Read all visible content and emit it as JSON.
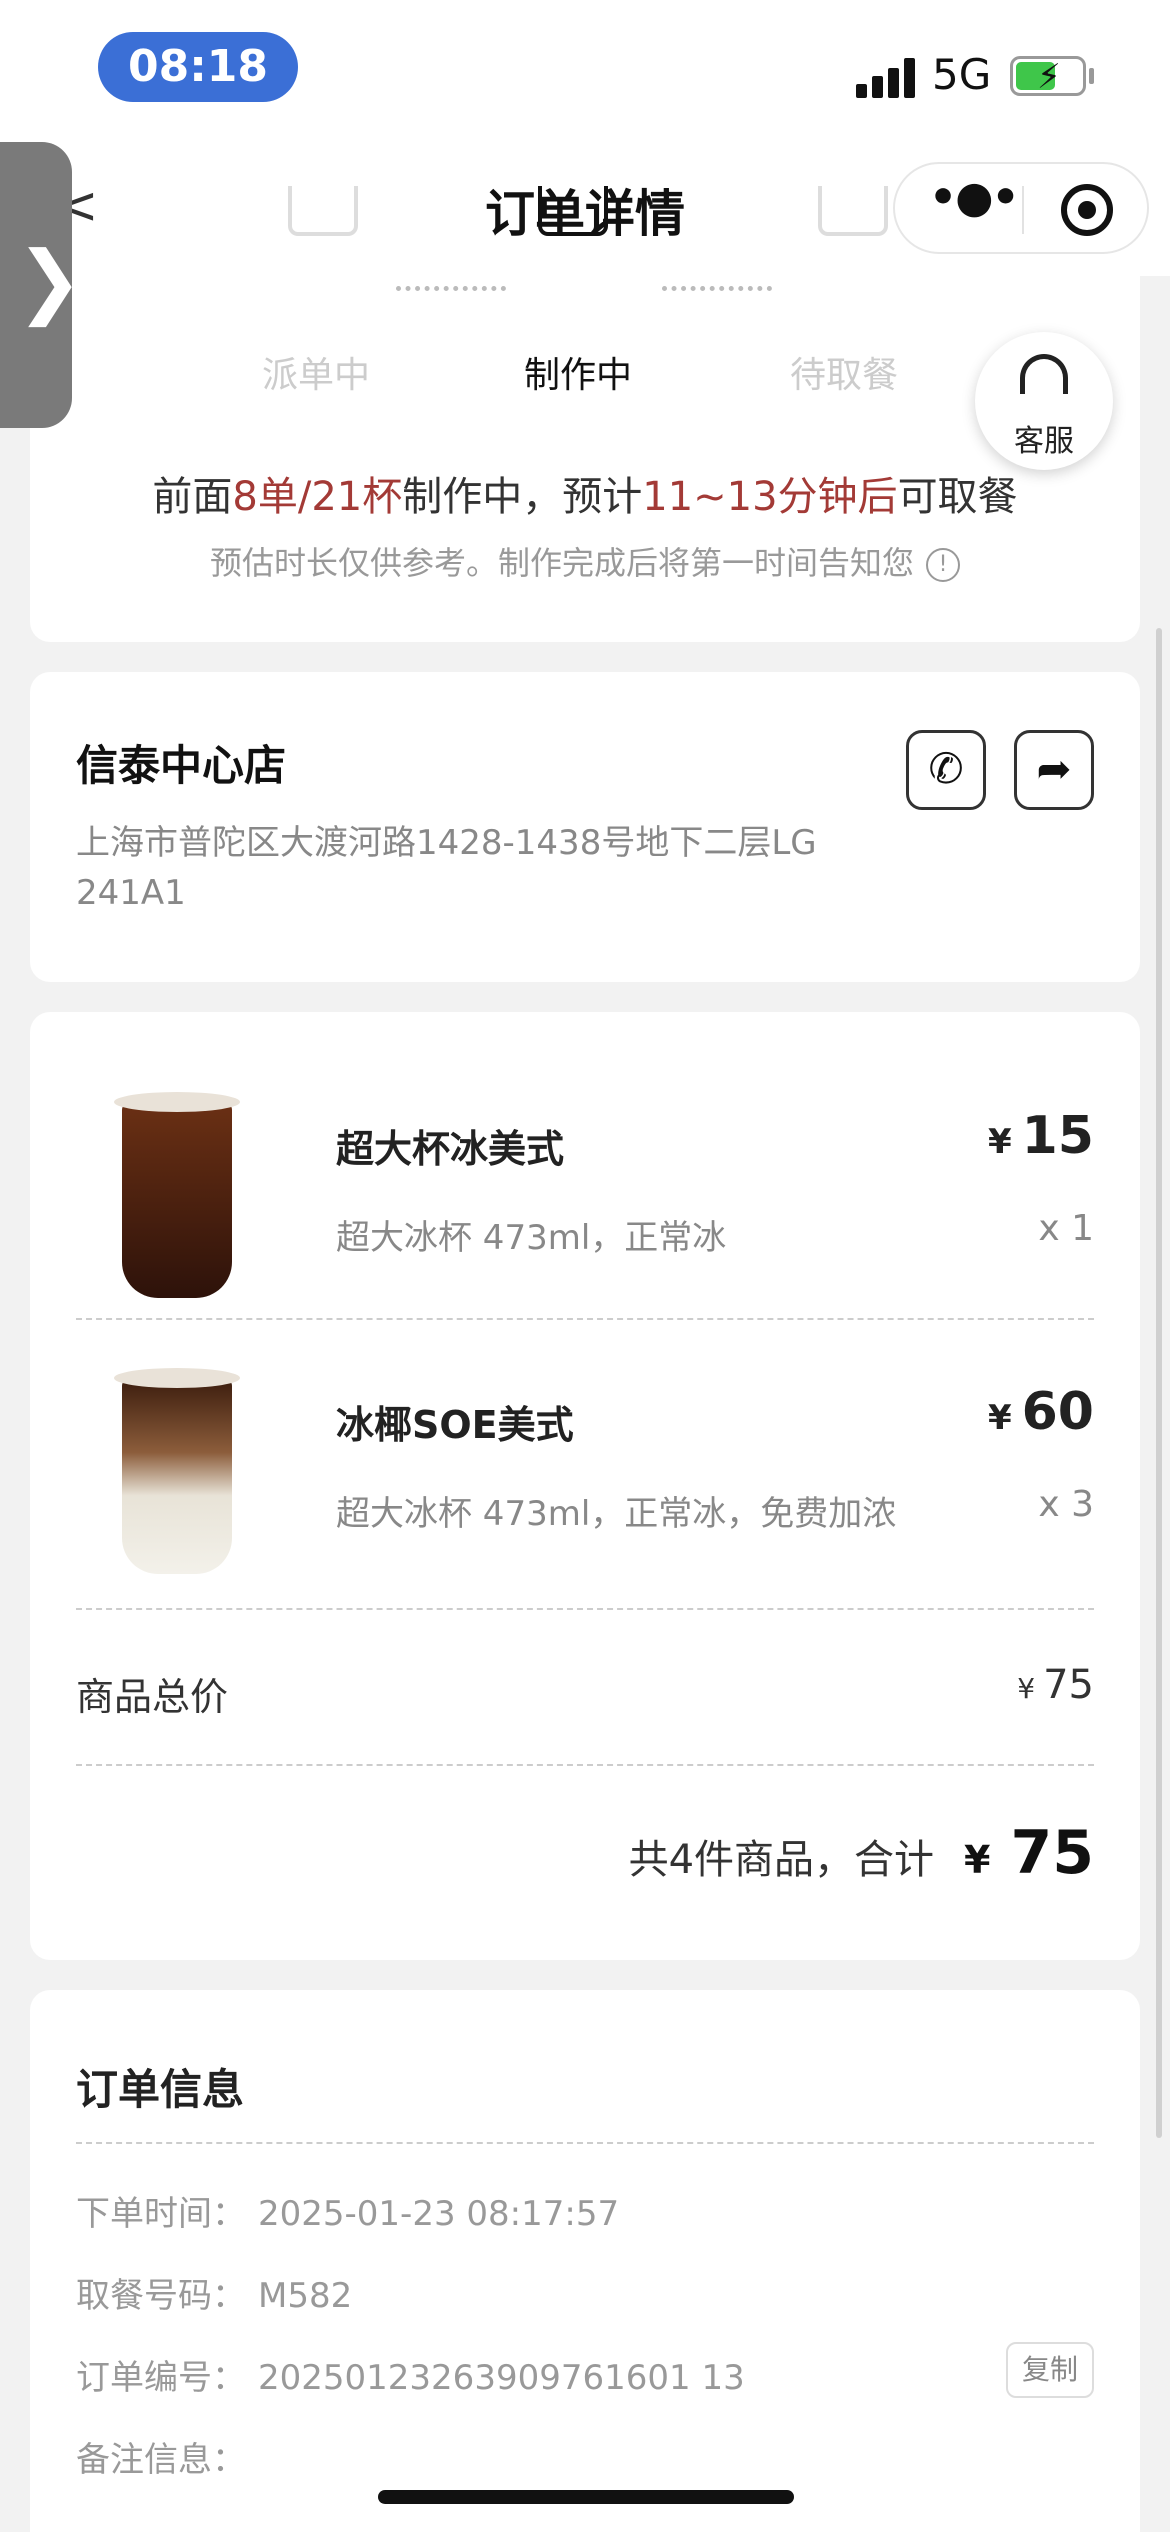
{
  "status_bar": {
    "time": "08:18",
    "network": "5G"
  },
  "nav": {
    "title": "订单详情",
    "more_icon": "more-dots-icon",
    "close_icon": "target-circle-icon"
  },
  "side_handle": {
    "chevron": "❯"
  },
  "progress": {
    "steps": [
      {
        "label": "派单中",
        "active": false
      },
      {
        "label": "制作中",
        "active": true
      },
      {
        "label": "待取餐",
        "active": false
      }
    ],
    "queue_prefix": "前面",
    "queue_count": "8单/21杯",
    "queue_mid": "制作中，预计",
    "queue_eta": "11~13分钟后",
    "queue_suffix": "可取餐",
    "note": "预估时长仅供参考。制作完成后将第一时间告知您",
    "info_glyph": "!"
  },
  "customer_service": {
    "label": "客服"
  },
  "store": {
    "name": "信泰中心店",
    "address": "上海市普陀区大渡河路1428-1438号地下二层LG 241A1",
    "phone_icon": "✆",
    "nav_icon": "➦"
  },
  "items": [
    {
      "name": "超大杯冰美式",
      "spec": "超大冰杯 473ml，正常冰",
      "currency": "¥",
      "price": "15",
      "qty": "x 1"
    },
    {
      "name": "冰椰SOE美式",
      "spec": "超大冰杯 473ml，正常冰，免费加浓",
      "currency": "¥",
      "price": "60",
      "qty": "x 3"
    }
  ],
  "summary": {
    "subtotal_label": "商品总价",
    "subtotal_currency": "¥",
    "subtotal_value": "75",
    "total_text": "共4件商品，合计",
    "total_currency": "¥",
    "total_value": "75"
  },
  "order_info": {
    "title": "订单信息",
    "rows": [
      {
        "label": "下单时间：",
        "value": "2025-01-23 08:17:57"
      },
      {
        "label": "取餐号码：",
        "value": "M582"
      },
      {
        "label": "订单编号：",
        "value": "20250123263909761601 13"
      },
      {
        "label": "备注信息：",
        "value": ""
      }
    ],
    "copy_label": "复制"
  }
}
